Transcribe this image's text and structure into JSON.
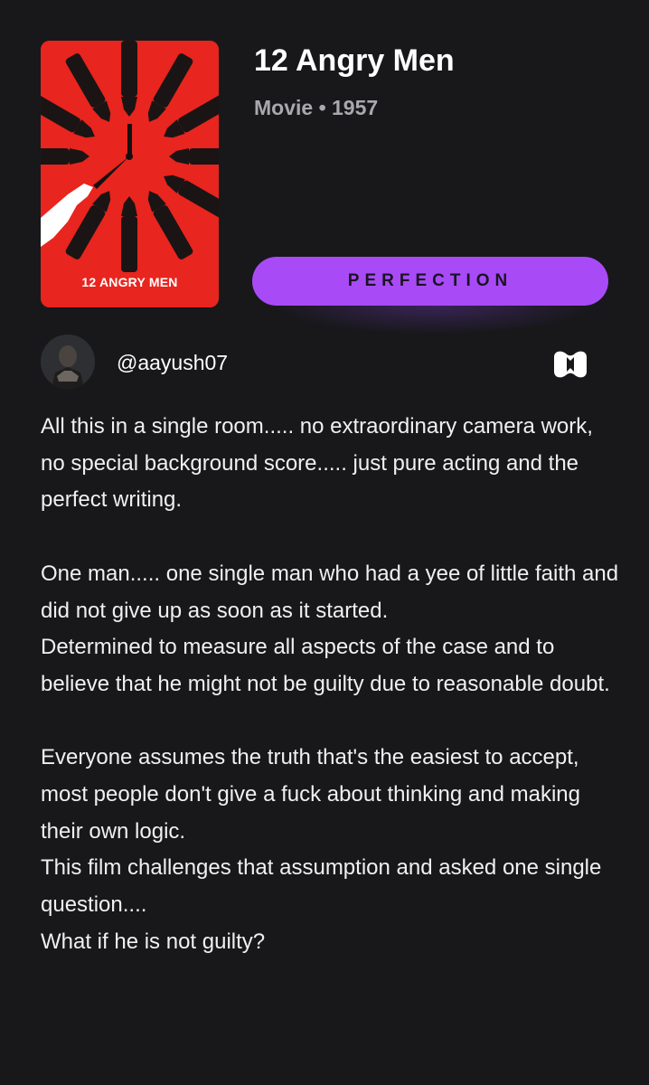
{
  "item": {
    "title": "12 Angry Men",
    "meta": "Movie • 1957",
    "poster": {
      "caption": "12 ANGRY MEN",
      "background_color": "#e8251e",
      "content": "clock-and-pointing-hands-illustration"
    }
  },
  "rating": {
    "label": "PERFECTION",
    "color": "#a84bf7"
  },
  "author": {
    "username": "@aayush07",
    "avatar": "user-avatar"
  },
  "brand_icon": "app-logo-icon",
  "review": {
    "paragraphs": [
      "All this in a single room..... no extraordinary camera work, no special background score..... just pure acting and the perfect writing.",
      "One man..... one single man who had a yee of little faith and did not give up as soon as it started.\nDetermined to measure all aspects of the case and to believe that he might not be guilty due to reasonable doubt.",
      "Everyone assumes the truth that's the easiest to accept, most people don't give a fuck about thinking and making their own logic.\nThis film challenges that assumption and asked one single question....\nWhat if he is not guilty?"
    ]
  }
}
